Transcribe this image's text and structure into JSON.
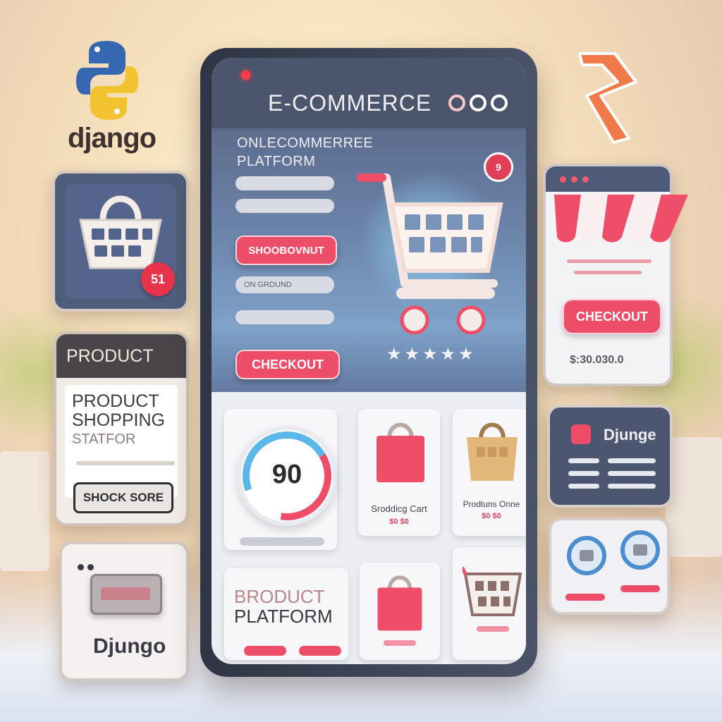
{
  "logos": {
    "top_left_text": "django",
    "bottom_left_text": "Djungo",
    "right_panel_name": "Djunge"
  },
  "left_panels": {
    "basket_badge": "51",
    "product_header": "PRODUCT",
    "product_body_line1": "PRODUCT",
    "product_body_line2": "SHOPPING",
    "product_body_line3": "STATFOR",
    "product_button": "SHOCK SORE"
  },
  "device": {
    "title": "E-COMMERCE",
    "hero_line1": "ONLECOMMERREE",
    "hero_line2": "PLATFORM",
    "hero_badge": "9",
    "btn_shop": "SHOOBOVNUT",
    "field_text": "ON GRDUND",
    "btn_checkout": "CHECKOUT",
    "stars": "★★★★★",
    "gauge_value": "90",
    "tile_a_text": "Sroddicg Cart",
    "tile_a_price": "$0 $0",
    "tile_b_text": "Prodtuns Onne",
    "tile_b_price": "$0 $0",
    "bottom_title_line1": "BRODUCT",
    "bottom_title_line2": "PLATFORM"
  },
  "right_panels": {
    "checkout": "CHECKOUT",
    "price": "$:30.030.0"
  },
  "colors": {
    "accent_pink": "#ee4d69",
    "device_dark": "#4b556c",
    "python_blue": "#3568b0",
    "python_yellow": "#f2c230"
  }
}
